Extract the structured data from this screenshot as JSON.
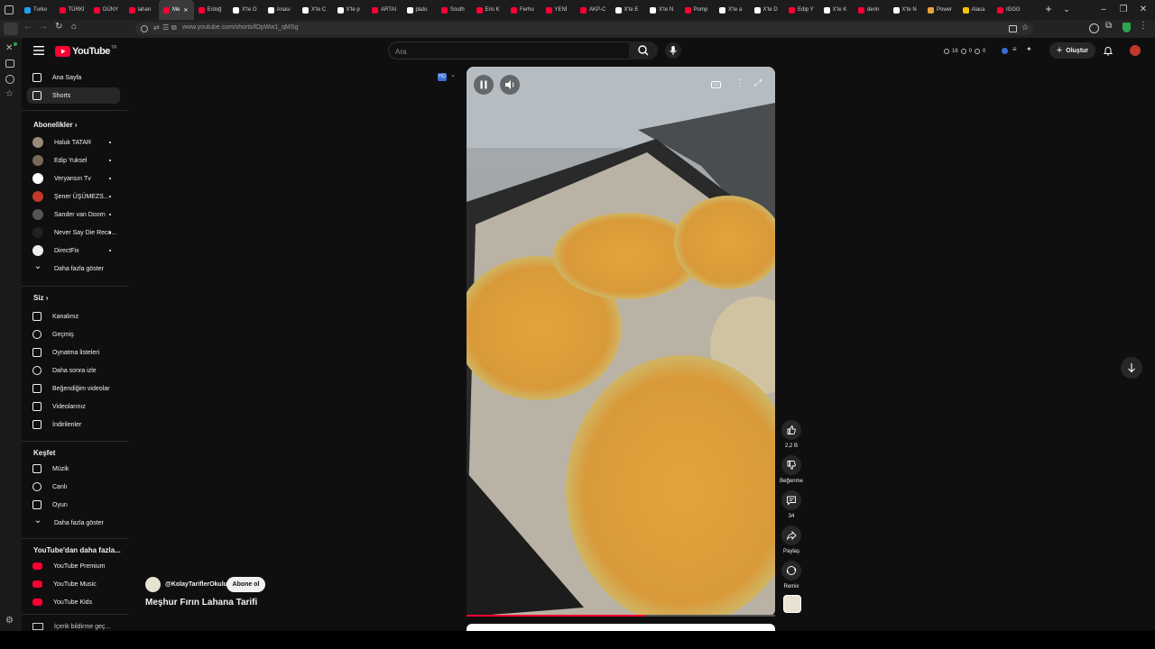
{
  "browser": {
    "tabs": [
      {
        "label": "Turko",
        "color": "#1da1f2"
      },
      {
        "label": "TÜRKİ",
        "color": "#ff0033"
      },
      {
        "label": "DÜNY",
        "color": "#ff0033"
      },
      {
        "label": "lahan",
        "color": "#ff0033"
      },
      {
        "label": "Me",
        "color": "#ff0033",
        "active": true
      },
      {
        "label": "Erdoğ",
        "color": "#ff0033"
      },
      {
        "label": "X'te O",
        "color": "#ffffff"
      },
      {
        "label": "Anası",
        "color": "#ffffff"
      },
      {
        "label": "X'te C",
        "color": "#ffffff"
      },
      {
        "label": "X'te p",
        "color": "#ffffff"
      },
      {
        "label": "ARTAI",
        "color": "#ff0033"
      },
      {
        "label": "plato",
        "color": "#ffffff"
      },
      {
        "label": "South",
        "color": "#ff0033"
      },
      {
        "label": "Eris K",
        "color": "#ff0033"
      },
      {
        "label": "Ferhu",
        "color": "#ff0033"
      },
      {
        "label": "YENİ",
        "color": "#ff0033"
      },
      {
        "label": "AKP-C",
        "color": "#ff0033"
      },
      {
        "label": "X'te E",
        "color": "#ffffff"
      },
      {
        "label": "X'te N",
        "color": "#ffffff"
      },
      {
        "label": "Pomp",
        "color": "#ff0033"
      },
      {
        "label": "X'te a",
        "color": "#ffffff"
      },
      {
        "label": "X'te D",
        "color": "#ffffff"
      },
      {
        "label": "Edip Y",
        "color": "#ff0033"
      },
      {
        "label": "X'te K",
        "color": "#ffffff"
      },
      {
        "label": "derin",
        "color": "#ff0033"
      },
      {
        "label": "X'te N",
        "color": "#ffffff"
      },
      {
        "label": "Power",
        "color": "#e8a33d"
      },
      {
        "label": "Alaca",
        "color": "#f5c400"
      },
      {
        "label": "IGGG",
        "color": "#ff0033"
      }
    ],
    "url": "www.youtube.com/shorts/lOpWw1_qMSg"
  },
  "header": {
    "logo": "YouTube",
    "logo_country": "TR",
    "search_placeholder": "Ara",
    "stats": [
      "16",
      "0",
      "0"
    ],
    "create_label": "Oluştur"
  },
  "sidebar": {
    "main": [
      {
        "label": "Ana Sayfa",
        "icon": "home-icon"
      },
      {
        "label": "Shorts",
        "icon": "shorts-icon",
        "active": true
      }
    ],
    "subs_title": "Abonelikler",
    "subs": [
      {
        "label": "Haluk TATAR",
        "color": "#9a8a7a"
      },
      {
        "label": "Edip Yuksel",
        "color": "#7a6a5a"
      },
      {
        "label": "Veryansın Tv",
        "color": "#ffffff"
      },
      {
        "label": "Şener ÜŞÜMEZS...",
        "color": "#c0392b"
      },
      {
        "label": "Sander van Doorn",
        "color": "#555555"
      },
      {
        "label": "Never Say Die Reco...",
        "color": "#222222"
      },
      {
        "label": "DirectFix",
        "color": "#eeeeee"
      }
    ],
    "subs_more": "Daha fazla göster",
    "you_title": "Siz",
    "you": [
      {
        "label": "Kanalınız",
        "icon": "channel-icon"
      },
      {
        "label": "Geçmiş",
        "icon": "history-icon"
      },
      {
        "label": "Oynatma listeleri",
        "icon": "playlists-icon"
      },
      {
        "label": "Daha sonra izle",
        "icon": "watch-later-icon"
      },
      {
        "label": "Beğendiğim videolar",
        "icon": "liked-icon"
      },
      {
        "label": "Videolarınız",
        "icon": "your-videos-icon"
      },
      {
        "label": "İndirilenler",
        "icon": "downloads-icon"
      }
    ],
    "explore_title": "Keşfet",
    "explore": [
      {
        "label": "Müzik",
        "icon": "music-icon"
      },
      {
        "label": "Canlı",
        "icon": "live-icon"
      },
      {
        "label": "Oyun",
        "icon": "gaming-icon"
      }
    ],
    "explore_more": "Daha fazla göster",
    "more_title": "YouTube'dan daha fazla...",
    "more": [
      {
        "label": "YouTube Premium"
      },
      {
        "label": "YouTube Music"
      },
      {
        "label": "YouTube Kids"
      }
    ],
    "cut_off": "İçerik bildirme geç..."
  },
  "short": {
    "channel": "@KolayTariflerOkulu",
    "subscribe": "Abone ol",
    "title": "Meşhur Fırın Lahana Tarifi",
    "likes": "2,2 B",
    "dislike_label": "Beğenme",
    "comments": "34",
    "share_label": "Paylaş",
    "remix_label": "Remix",
    "progress": 0.58
  }
}
